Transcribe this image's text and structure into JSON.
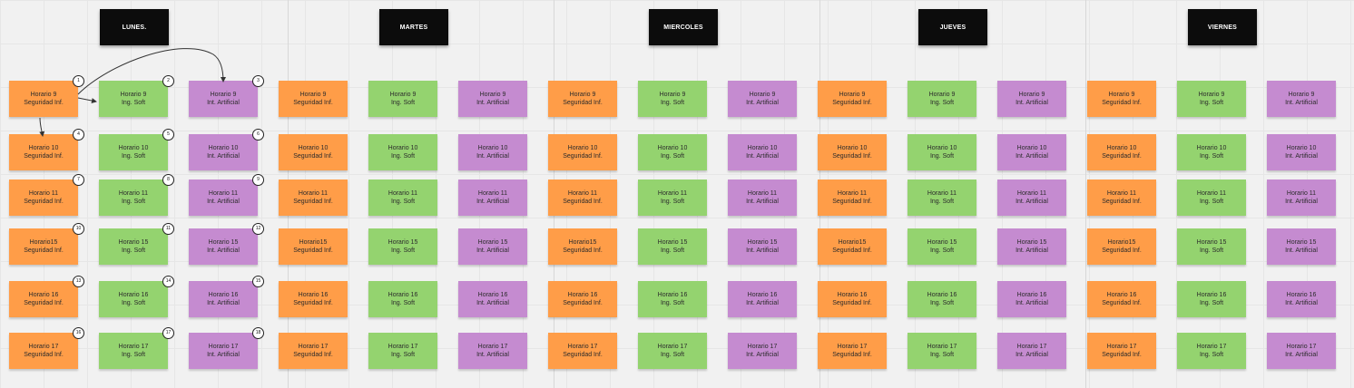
{
  "days": [
    "LUNES.",
    "MARTES",
    "MIERCOLES",
    "JUEVES",
    "VIERNES"
  ],
  "slots": [
    "Horario 9",
    "Horario 10",
    "Horario 11",
    "Horario15",
    "Horario 16",
    "Horario 17"
  ],
  "slots_short": [
    "Horario 9",
    "Horario 10",
    "Horario 11",
    "Horario 15",
    "Horario 16",
    "Horario 17"
  ],
  "subjects": {
    "orange": "Seguridad Inf.",
    "green": "Ing. Soft",
    "purple": "Int. Artificial"
  },
  "colors": {
    "orange": "#ff9d48",
    "green": "#94d36f",
    "purple": "#c58bd0",
    "header": "#0c0c0c",
    "background": "#f1f1f1"
  },
  "badges": {
    "orange": [
      "1",
      "4",
      "7",
      "10",
      "13",
      "16"
    ],
    "green": [
      "2",
      "5",
      "8",
      "11",
      "14",
      "17"
    ],
    "purple": [
      "3",
      "6",
      "9",
      "12",
      "15",
      "18"
    ]
  }
}
